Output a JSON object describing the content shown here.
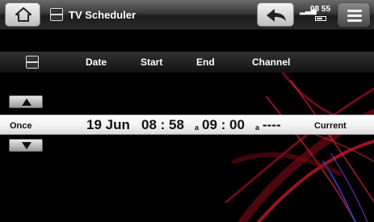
{
  "header": {
    "title": "TV Scheduler",
    "clock": "08 55",
    "battery_level": 0.7
  },
  "columns": {
    "date": "Date",
    "start": "Start",
    "end": "End",
    "channel": "Channel"
  },
  "entry": {
    "repeat": "Once",
    "date": "19 Jun",
    "start_time": "08 : 58",
    "start_ampm": "a",
    "end_time": "09 : 00",
    "end_ampm": "a",
    "channel": "----",
    "status": "Current"
  },
  "colors": {
    "row_background": "#f3f3f3",
    "background": "#000000",
    "accent_streaks": "#c0182a"
  }
}
